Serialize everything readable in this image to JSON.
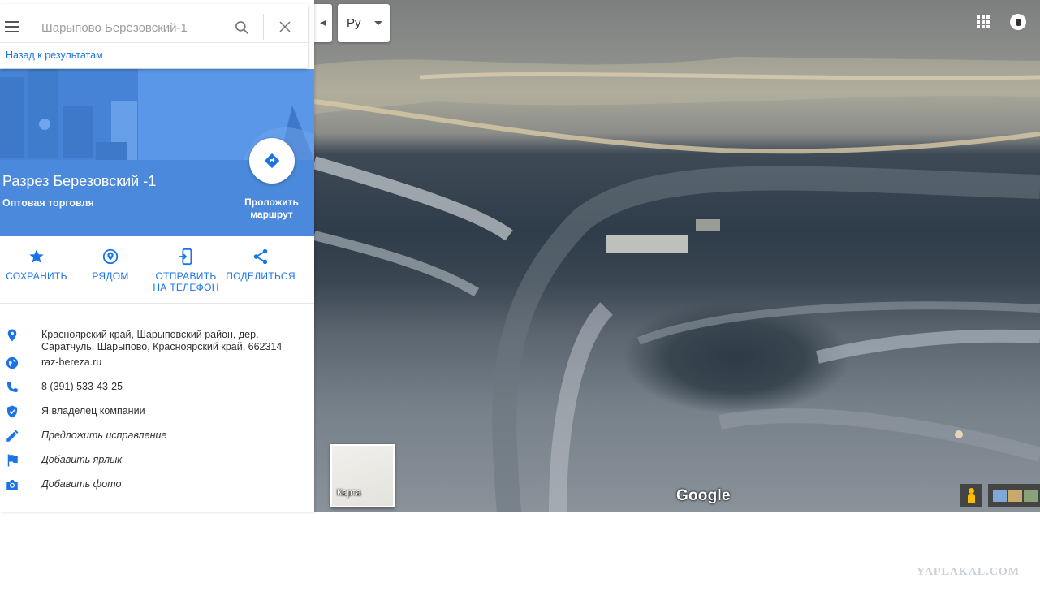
{
  "search": {
    "placeholder": "Шарыпово Берёзовский-1",
    "back_link": "Назад к результатам"
  },
  "place": {
    "title": "Разрез Березовский -1",
    "category": "Оптовая торговля",
    "route_label": "Проложить маршрут"
  },
  "actions": [
    {
      "label": "СОХРАНИТЬ",
      "icon": "star-icon"
    },
    {
      "label": "РЯДОМ",
      "icon": "nearby-icon"
    },
    {
      "label": "ОТПРАВИТЬ НА ТЕЛЕФОН",
      "icon": "send-to-phone-icon"
    },
    {
      "label": "ПОДЕЛИТЬСЯ",
      "icon": "share-icon"
    }
  ],
  "info": {
    "address": "Красноярский край, Шарыповский район, дер. Саратчуль, Шарыпово, Красноярский край, 662314",
    "website": "raz-bereza.ru",
    "phone": "8 (391) 533-43-25",
    "owner": "Я владелец компании",
    "suggest_edit": "Предложить исправление",
    "add_label": "Добавить ярлык",
    "add_photo": "Добавить фото"
  },
  "map": {
    "language": "Ру",
    "layer_label": "Карта",
    "logo": "Google"
  },
  "watermark": "YAPLAKAL.COM",
  "colors": {
    "accent": "#1a73e8",
    "hero": "#4a89dc"
  }
}
